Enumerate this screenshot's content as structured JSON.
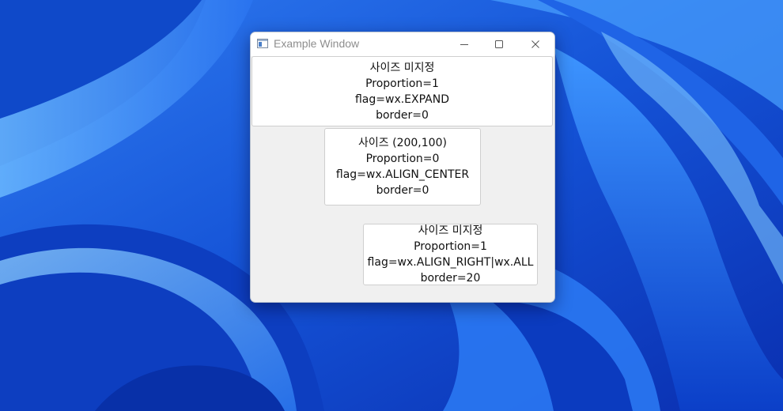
{
  "window": {
    "title": "Example Window",
    "icon": "app-window-icon",
    "controls": {
      "minimize": "minimize-icon",
      "maximize": "maximize-icon",
      "close": "close-icon"
    }
  },
  "panels": [
    {
      "lines": [
        "사이즈 미지정",
        "Proportion=1",
        "flag=wx.EXPAND",
        "border=0"
      ]
    },
    {
      "lines": [
        "사이즈 (200,100)",
        "Proportion=0",
        "flag=wx.ALIGN_CENTER",
        "border=0"
      ]
    },
    {
      "lines": [
        "사이즈 미지정",
        "Proportion=1",
        "flag=wx.ALIGN_RIGHT|wx.ALL",
        "border=20"
      ]
    }
  ],
  "colors": {
    "desktop_base": "#1a5fd8",
    "window_bg": "#f0f0f0",
    "titlebar_bg": "#ffffff",
    "panel_bg": "#ffffff"
  }
}
